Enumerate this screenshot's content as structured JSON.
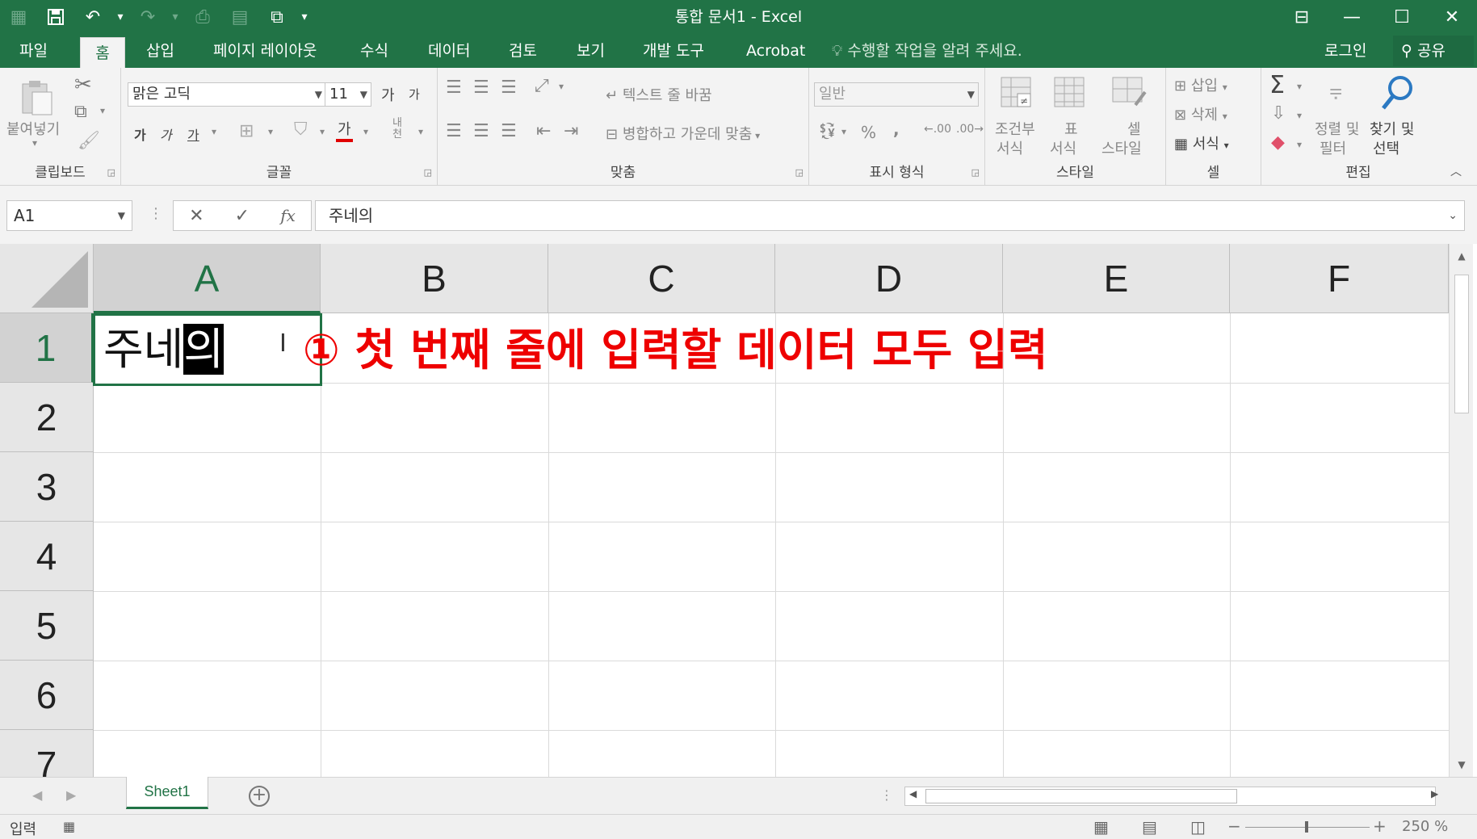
{
  "window": {
    "title": "통합 문서1 - Excel",
    "accent_color": "#217346"
  },
  "quick_access": [
    "save-icon",
    "undo-icon",
    "redo-icon",
    "print-preview-icon",
    "form-icon",
    "camera-icon",
    "customize-icon"
  ],
  "ribbon_tabs": [
    "파일",
    "홈",
    "삽입",
    "페이지 레이아웃",
    "수식",
    "데이터",
    "검토",
    "보기",
    "개발 도구",
    "Acrobat"
  ],
  "active_tab": "홈",
  "tell_me": "수행할 작업을 알려 주세요.",
  "account": {
    "login": "로그인",
    "share": "공유"
  },
  "ribbon": {
    "clipboard": {
      "label": "클립보드",
      "paste": "붙여넣기"
    },
    "font": {
      "label": "글꼴",
      "font_name": "맑은 고딕",
      "font_size": "11",
      "grow": "가",
      "shrink": "가",
      "bold": "가",
      "italic": "가",
      "underline": "가",
      "font_color": "가",
      "phonetic": "내천"
    },
    "alignment": {
      "label": "맞춤",
      "wrap_text": "텍스트 줄 바꿈",
      "merge_center": "병합하고 가운데 맞춤"
    },
    "number": {
      "label": "표시 형식",
      "format": "일반",
      "percent": "%",
      "comma": ",",
      "inc_decimal": ".00",
      "dec_decimal": ".00"
    },
    "styles": {
      "label": "스타일",
      "conditional": [
        "조건부",
        "서식"
      ],
      "table": [
        "표",
        "서식"
      ],
      "cell_styles": [
        "셀",
        "스타일"
      ]
    },
    "cells": {
      "label": "셀",
      "insert": "삽입",
      "delete": "삭제",
      "format": "서식"
    },
    "editing": {
      "label": "편집",
      "sort": [
        "정렬 및",
        "필터"
      ],
      "find": [
        "찾기 및",
        "선택"
      ]
    }
  },
  "formula_bar": {
    "name_box": "A1",
    "fx": "fx",
    "content": "주네의"
  },
  "grid": {
    "columns": [
      "A",
      "B",
      "C",
      "D",
      "E",
      "F"
    ],
    "rows": [
      "1",
      "2",
      "3",
      "4",
      "5",
      "6",
      "7"
    ],
    "active_cell_prefix": "주네",
    "active_cell_composing": "의"
  },
  "annotation": {
    "text": "① 첫 번째 줄에 입력할 데이터 모두 입력",
    "color": "#ee0000"
  },
  "sheets": [
    "Sheet1"
  ],
  "status": {
    "mode": "입력",
    "zoom": "250 %"
  }
}
